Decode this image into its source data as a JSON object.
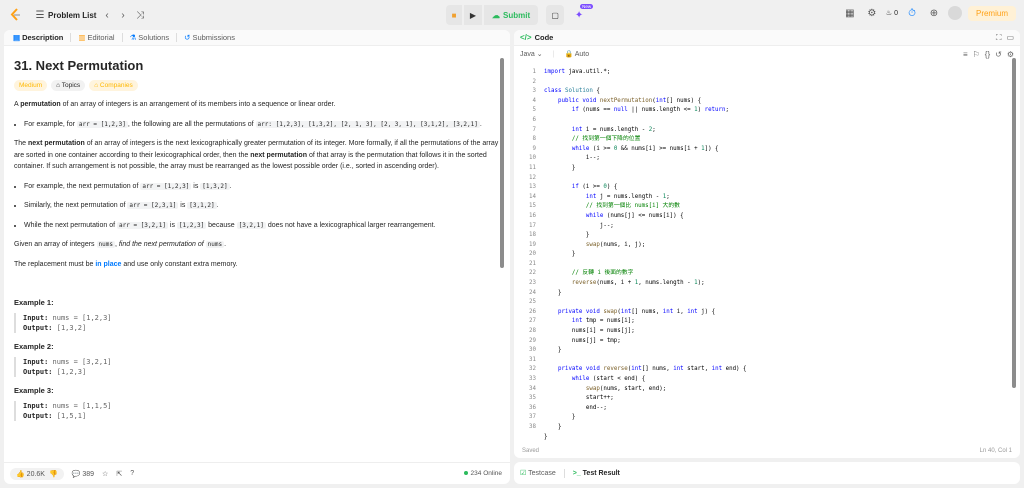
{
  "topbar": {
    "problem_list": "Problem List",
    "submit": "Submit",
    "new_badge": "New",
    "streak": "0",
    "premium": "Premium"
  },
  "left_tabs": [
    "Description",
    "Editorial",
    "Solutions",
    "Submissions"
  ],
  "problem": {
    "title": "31. Next Permutation",
    "tags": [
      "Medium",
      "Topics",
      "Companies"
    ],
    "p1_pre": "A ",
    "p1_b": "permutation",
    "p1_post": " of an array of integers is an arrangement of its members into a sequence or linear order.",
    "li1_pre": "For example, for ",
    "li1_c1": "arr = [1,2,3]",
    "li1_mid": ", the following are all the permutations of ",
    "li1_c2": "arr: [1,2,3], [1,3,2], [2, 1, 3], [2, 3, 1], [3,1,2], [3,2,1]",
    "li1_post": ".",
    "p2_pre": "The ",
    "p2_b1": "next permutation",
    "p2_mid": " of an array of integers is the next lexicographically greater permutation of its integer. More formally, if all the permutations of the array are sorted in one container according to their lexicographical order, then the ",
    "p2_b2": "next permutation",
    "p2_post": " of that array is the permutation that follows it in the sorted container. If such arrangement is not possible, the array must be rearranged as the lowest possible order (i.e., sorted in ascending order).",
    "li2_pre": "For example, the next permutation of ",
    "li2_c1": "arr = [1,2,3]",
    "li2_mid": " is ",
    "li2_c2": "[1,3,2]",
    "li2_post": ".",
    "li3_pre": "Similarly, the next permutation of ",
    "li3_c1": "arr = [2,3,1]",
    "li3_mid": " is ",
    "li3_c2": "[3,1,2]",
    "li3_post": ".",
    "li4_pre": "While the next permutation of ",
    "li4_c1": "arr = [3,2,1]",
    "li4_mid": " is ",
    "li4_c2": "[1,2,3]",
    "li4_mid2": " because ",
    "li4_c3": "[3,2,1]",
    "li4_post": " does not have a lexicographical larger rearrangement.",
    "p3_pre": "Given an array of integers ",
    "p3_c": "nums",
    "p3_mid": ", ",
    "p3_i": "find the next permutation of",
    "p3_c2": "nums",
    "p3_post": ".",
    "p4_pre": "The replacement must be ",
    "p4_b": "in place",
    "p4_post": " and use only constant extra memory.",
    "examples": [
      {
        "title": "Example 1:",
        "input_label": "Input:",
        "input": "nums = [1,2,3]",
        "output_label": "Output:",
        "output": "[1,3,2]"
      },
      {
        "title": "Example 2:",
        "input_label": "Input:",
        "input": "nums = [3,2,1]",
        "output_label": "Output:",
        "output": "[1,2,3]"
      },
      {
        "title": "Example 3:",
        "input_label": "Input:",
        "input": "nums = [1,1,5]",
        "output_label": "Output:",
        "output": "[1,5,1]"
      }
    ]
  },
  "footer": {
    "likes": "20.6K",
    "comments": "389",
    "online": "234 Online"
  },
  "code_panel": {
    "title": "Code",
    "language": "Java",
    "mode": "Auto",
    "status": "Saved",
    "cursor": "Ln 40, Col 1"
  },
  "bottom_tabs": [
    "Testcase",
    "Test Result"
  ]
}
